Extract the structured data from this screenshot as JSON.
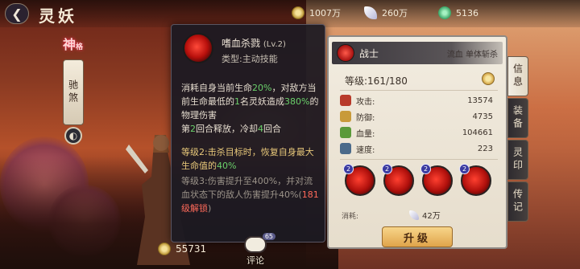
{
  "header": {
    "back_label": "❮",
    "title": "灵妖",
    "currencies": [
      {
        "icon": "coin-icon",
        "value": "1007万"
      },
      {
        "icon": "feather-icon",
        "value": "260万"
      },
      {
        "icon": "jade-icon",
        "value": "5136"
      }
    ]
  },
  "left_tabs": {
    "shen_label": "神",
    "shen_sub": "格",
    "scroll_label": "驰煞",
    "circle_label": "◐"
  },
  "skill_tooltip": {
    "name": "嗜血杀戮",
    "level": "(Lv.2)",
    "type_text": "类型:主动技能",
    "desc_1": "消耗自身当前生命",
    "desc_pct1": "20%",
    "desc_2": "，对敌方当前生命最低的",
    "desc_count": "1",
    "desc_3": "名灵妖造成",
    "desc_pct2": "380%",
    "desc_4": "的物理伤害",
    "desc_5a": "第",
    "desc_round": "2",
    "desc_5b": "回合释放，冷却",
    "desc_cd": "4",
    "desc_5c": "回合",
    "lvl2_text": "等级2:击杀目标时，恢复自身最大生命值的",
    "lvl2_pct": "40%",
    "lvl3_text": "等级3:伤害提升至400%，并对流血状态下的敌人伤害提升40%(",
    "lvl3_unlock": "181级解锁",
    "lvl3_end": ")"
  },
  "bottom": {
    "coin_value": "55731",
    "comment_label": "评论",
    "comment_count": "65"
  },
  "info_panel": {
    "class_name": "战士",
    "class_tag": "流血 单体斩杀",
    "level_text": "等级:161/180",
    "stats": [
      {
        "label": "攻击:",
        "value": "13574",
        "icon": "attack-icon",
        "color": "#b83a2a"
      },
      {
        "label": "防御:",
        "value": "4735",
        "icon": "defense-icon",
        "color": "#c89a3a"
      },
      {
        "label": "血量:",
        "value": "104661",
        "icon": "health-icon",
        "color": "#5a9a3a"
      },
      {
        "label": "速度:",
        "value": "223",
        "icon": "speed-icon",
        "color": "#4a6a8a"
      }
    ],
    "skills": [
      {
        "badge": "2"
      },
      {
        "badge": "2"
      },
      {
        "badge": "2"
      },
      {
        "badge": "2"
      }
    ],
    "cost_label": "消耗:",
    "cost_value": "42万",
    "upgrade_label": "升级"
  },
  "right_tabs": [
    {
      "label": "信息",
      "active": true
    },
    {
      "label": "装备",
      "active": false
    },
    {
      "label": "灵印",
      "active": false
    },
    {
      "label": "传记",
      "active": false
    }
  ],
  "colors": {
    "accent_red": "#b8100c",
    "highlight_green": "#6bd16b",
    "highlight_gold": "#e8c87a"
  }
}
